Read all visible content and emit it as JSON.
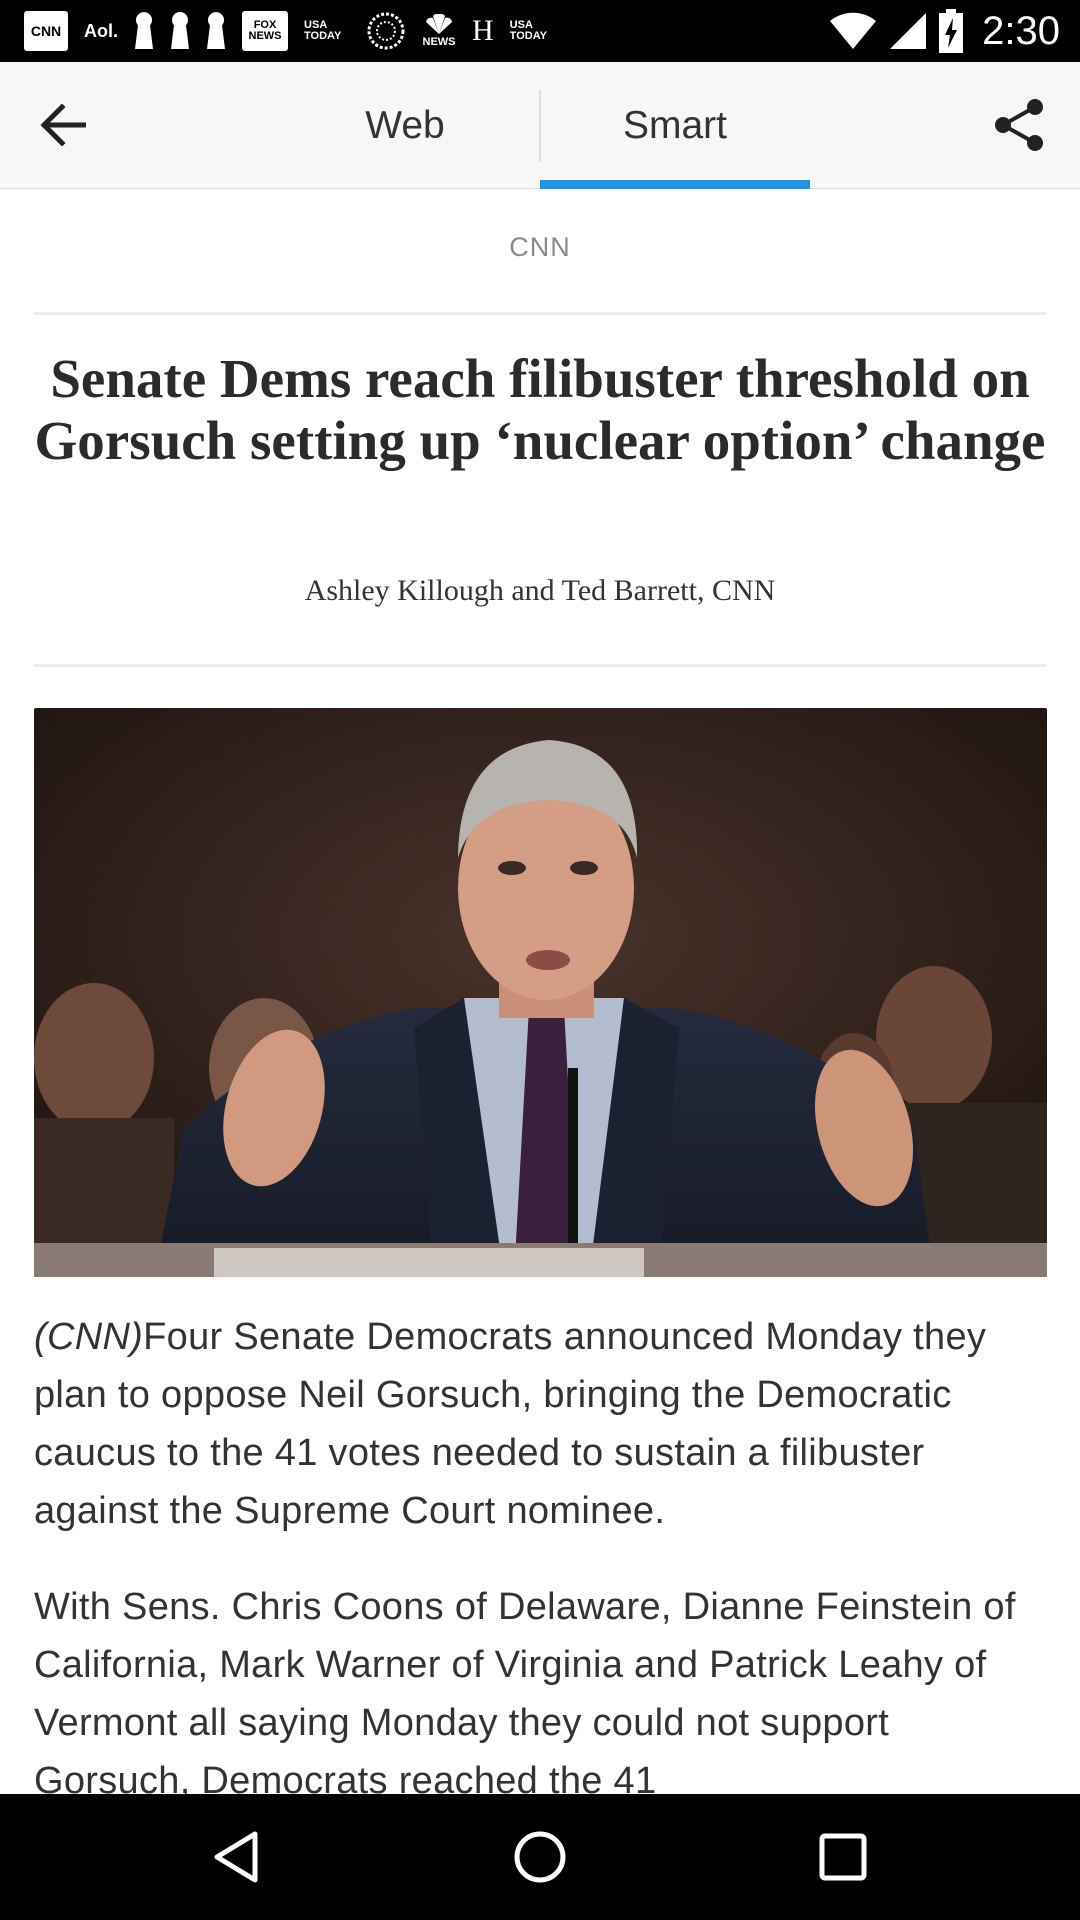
{
  "status_bar": {
    "notifications": [
      {
        "icon": "cnn-icon",
        "label": "CNN"
      },
      {
        "icon": "aol-icon",
        "label": "Aol."
      },
      {
        "icon": "keyhole-icon",
        "label": ""
      },
      {
        "icon": "keyhole-icon",
        "label": ""
      },
      {
        "icon": "keyhole-icon",
        "label": ""
      },
      {
        "icon": "fox-news-icon",
        "label": "FOX NEWS"
      },
      {
        "icon": "usa-today-icon",
        "label": "USA TODAY"
      },
      {
        "icon": "abc-news-icon",
        "label": ""
      },
      {
        "icon": "nbc-news-icon",
        "label": "NEWS"
      },
      {
        "icon": "huffpost-icon",
        "label": "H"
      },
      {
        "icon": "usa-today-icon",
        "label": "USA TODAY"
      }
    ],
    "time": "2:30",
    "icons": [
      "wifi-icon",
      "cell-signal-icon",
      "battery-charging-icon"
    ]
  },
  "toolbar": {
    "tabs": [
      {
        "label": "Web",
        "active": false
      },
      {
        "label": "Smart",
        "active": true
      }
    ],
    "accent": "#2196e6"
  },
  "article": {
    "source": "CNN",
    "headline": "Senate Dems reach filibuster threshold on Gorsuch setting up ‘nuclear option’ change",
    "byline": "Ashley Killough and Ted Barrett, CNN",
    "paragraphs": [
      {
        "lead": "(CNN)",
        "text": "Four Senate Democrats announced Monday they plan to oppose Neil Gorsuch, bringing the Democratic caucus to the 41 votes needed to sustain a filibuster against the Supreme Court nominee."
      },
      {
        "lead": "",
        "text": "With Sens. Chris Coons of Delaware, Dianne Feinstein of California, Mark Warner of Virginia and Patrick Leahy of Vermont all saying Monday they could not support Gorsuch, Democrats reached the 41"
      }
    ]
  },
  "navbar": {
    "icons": [
      "nav-back-icon",
      "nav-home-icon",
      "nav-recents-icon"
    ]
  }
}
